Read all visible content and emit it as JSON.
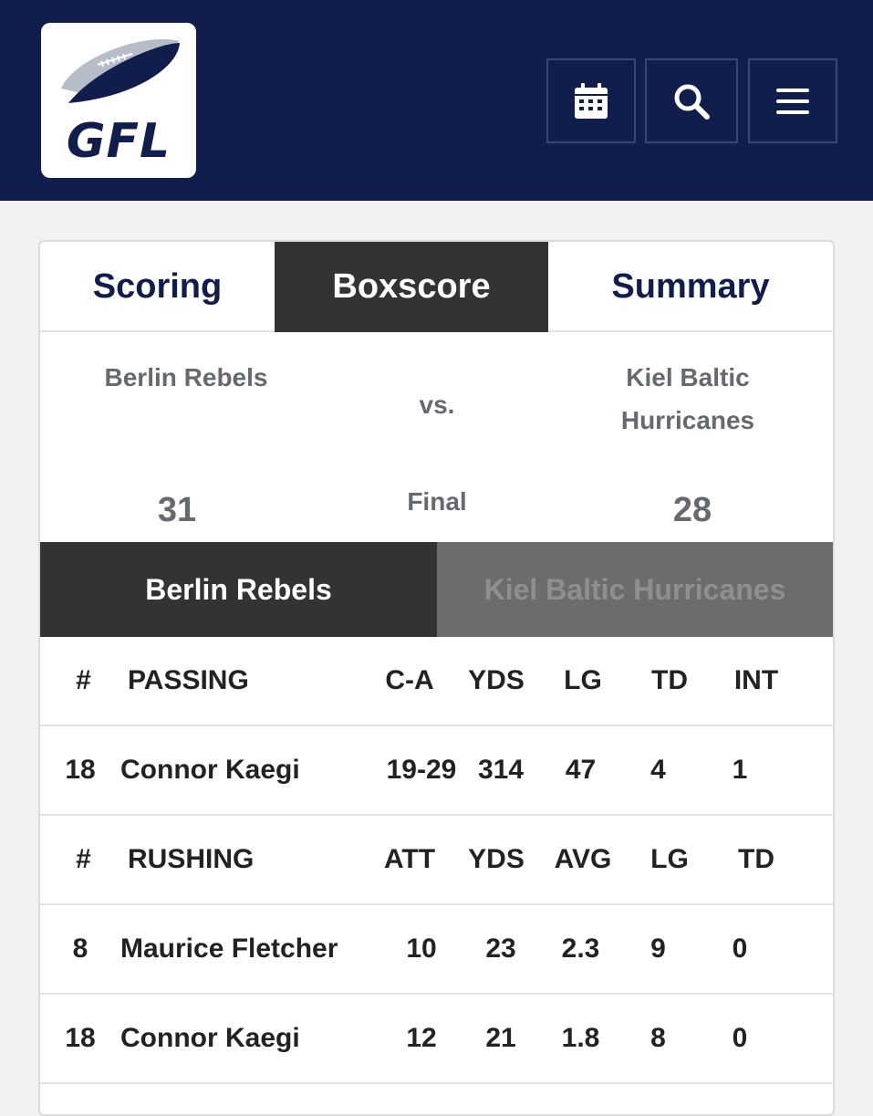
{
  "header": {
    "logo_text": "GFL",
    "buttons": [
      {
        "name": "calendar-button",
        "icon": "calendar-icon"
      },
      {
        "name": "search-button",
        "icon": "search-icon"
      },
      {
        "name": "menu-button",
        "icon": "hamburger-icon"
      }
    ],
    "colors": {
      "navbar": "#111d4a",
      "active_tab": "#333333",
      "inactive_team_tab": "#6c6c6c",
      "gray_text": "#666a6e"
    }
  },
  "tabs": [
    {
      "label": "Scoring",
      "active": false
    },
    {
      "label": "Boxscore",
      "active": true
    },
    {
      "label": "Summary",
      "active": false
    }
  ],
  "game": {
    "home_team": "Berlin Rebels",
    "away_team_line1": "Kiel Baltic",
    "away_team_line2": "Hurricanes",
    "vs": "vs.",
    "status": "Final",
    "home_score": "31",
    "away_score": "28"
  },
  "team_tabs": {
    "home": "Berlin Rebels",
    "away": "Kiel Baltic Hurricanes",
    "active": "home"
  },
  "passing": {
    "headers": [
      "#",
      "PASSING",
      "C-A",
      "YDS",
      "LG",
      "TD",
      "INT"
    ],
    "rows": [
      [
        "18",
        "Connor Kaegi",
        "19-29",
        "314",
        "47",
        "4",
        "1"
      ]
    ]
  },
  "rushing": {
    "headers": [
      "#",
      "RUSHING",
      "ATT",
      "YDS",
      "AVG",
      "LG",
      "TD"
    ],
    "rows": [
      [
        "8",
        "Maurice Fletcher",
        "10",
        "23",
        "2.3",
        "9",
        "0"
      ],
      [
        "18",
        "Connor Kaegi",
        "12",
        "21",
        "1.8",
        "8",
        "0"
      ]
    ]
  }
}
